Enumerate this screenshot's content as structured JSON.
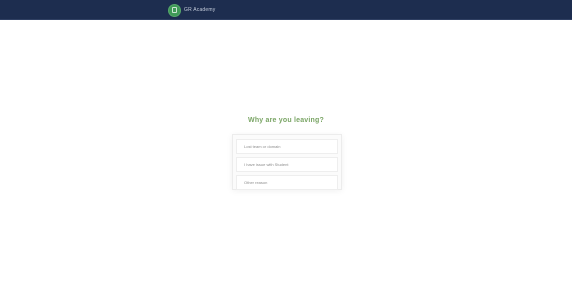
{
  "header": {
    "brand_name": "GR Academy",
    "logo_icon": "shield-logo-icon",
    "background_color": "#1d2d4f",
    "logo_color": "#3f9a57"
  },
  "main": {
    "prompt": "Why are you leaving?",
    "prompt_color": "#7aa565",
    "options": [
      {
        "label": "Lost team or domain"
      },
      {
        "label": "I have issue with Student"
      },
      {
        "label": "Other reason"
      }
    ]
  }
}
